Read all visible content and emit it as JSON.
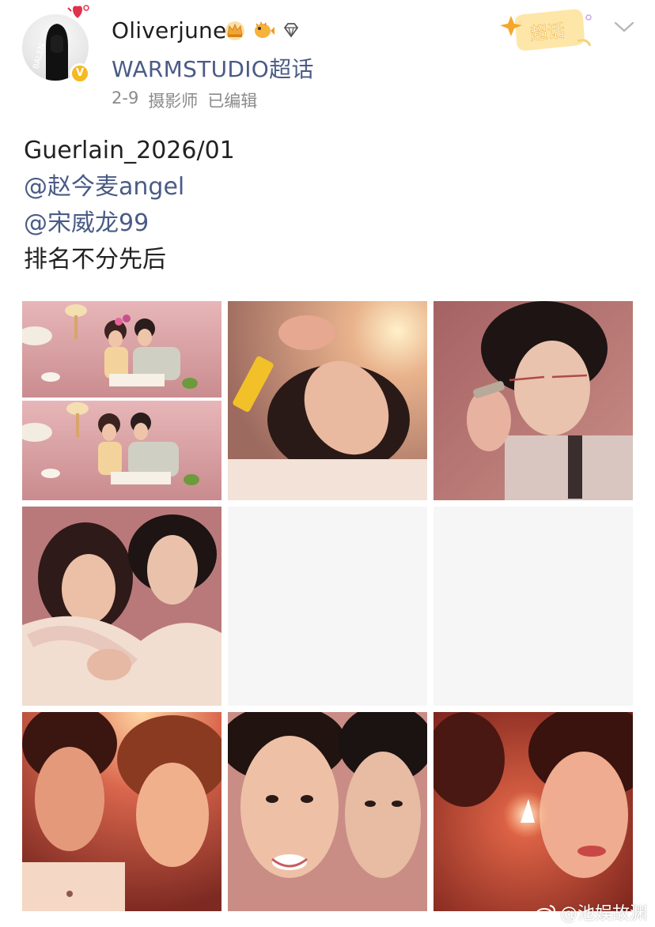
{
  "post": {
    "author": {
      "name": "Oliverjune",
      "avatar_icon": "avatar-figure-icon",
      "verified_icon": "verified-v-icon",
      "verified_label": "V"
    },
    "topic": "WARMSTUDIO超话",
    "meta": {
      "date": "2-9",
      "role": "摄影师",
      "edited": "已编辑"
    },
    "tag": {
      "label": "超话",
      "icon": "chaohua-sticker-icon"
    },
    "menu_icon": "chevron-down-icon",
    "text": {
      "line1": "Guerlain_2026/01",
      "mention1": "@赵今麦angel",
      "mention2": "@宋威龙99",
      "line4": "排名不分先后"
    },
    "colors": {
      "link": "#4a5b86",
      "meta": "#8a8a8a",
      "badge": "#f5b921"
    }
  },
  "photos": [
    {
      "name": "photo-1",
      "icon": "bedroom-couple-collage"
    },
    {
      "name": "photo-2",
      "icon": "woman-with-gold-lipstick"
    },
    {
      "name": "photo-3",
      "icon": "man-with-glasses"
    },
    {
      "name": "photo-4",
      "icon": "couple-with-blanket"
    },
    {
      "name": "photo-5",
      "icon": "blank"
    },
    {
      "name": "photo-6",
      "icon": "blank"
    },
    {
      "name": "photo-7",
      "icon": "couple-warm-light"
    },
    {
      "name": "photo-8",
      "icon": "couple-smiling"
    },
    {
      "name": "photo-9",
      "icon": "woman-with-light"
    }
  ],
  "watermark": {
    "text": "@池娱故渊",
    "icon": "weibo-logo-icon"
  }
}
